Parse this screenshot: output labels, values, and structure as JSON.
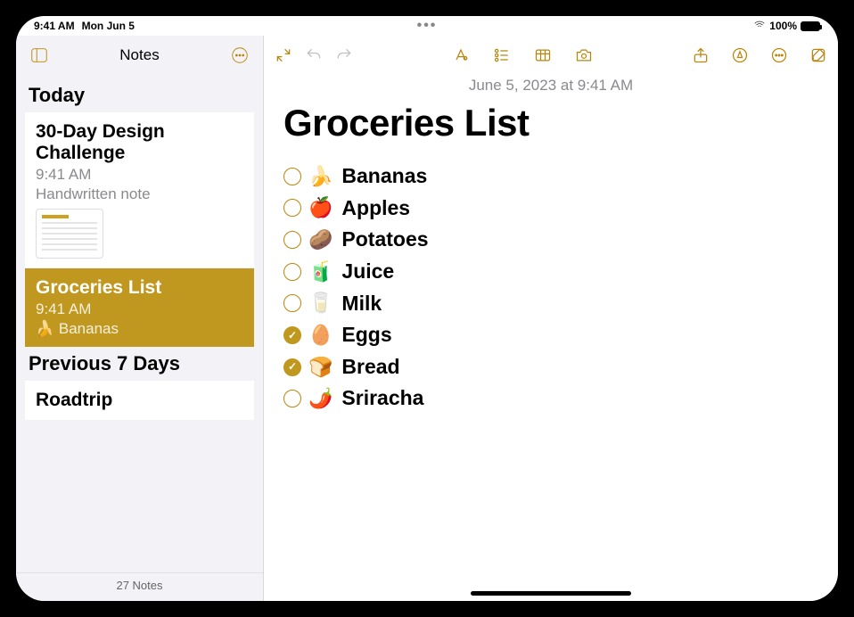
{
  "statusbar": {
    "time": "9:41 AM",
    "date": "Mon Jun 5",
    "handoff": "•••",
    "battery_label": "100%"
  },
  "sidebar": {
    "title": "Notes",
    "footer": "27 Notes",
    "sections": [
      {
        "label": "Today"
      },
      {
        "label": "Previous 7 Days"
      }
    ],
    "notes": {
      "design": {
        "title": "30-Day Design Challenge",
        "time": "9:41 AM",
        "preview": "Handwritten note"
      },
      "groceries": {
        "title": "Groceries List",
        "time": "9:41 AM",
        "preview": "🍌 Bananas"
      },
      "roadtrip": {
        "title": "Roadtrip"
      }
    }
  },
  "note": {
    "timestamp": "June 5, 2023 at 9:41 AM",
    "title": "Groceries List",
    "items": [
      {
        "emoji": "🍌",
        "label": "Bananas",
        "checked": false
      },
      {
        "emoji": "🍎",
        "label": "Apples",
        "checked": false
      },
      {
        "emoji": "🥔",
        "label": "Potatoes",
        "checked": false
      },
      {
        "emoji": "🧃",
        "label": "Juice",
        "checked": false
      },
      {
        "emoji": "🥛",
        "label": "Milk",
        "checked": false
      },
      {
        "emoji": "🥚",
        "label": "Eggs",
        "checked": true
      },
      {
        "emoji": "🍞",
        "label": "Bread",
        "checked": true
      },
      {
        "emoji": "🌶️",
        "label": "Sriracha",
        "checked": false
      }
    ]
  },
  "colors": {
    "accent": "#b8860b",
    "selected": "#c09820"
  }
}
